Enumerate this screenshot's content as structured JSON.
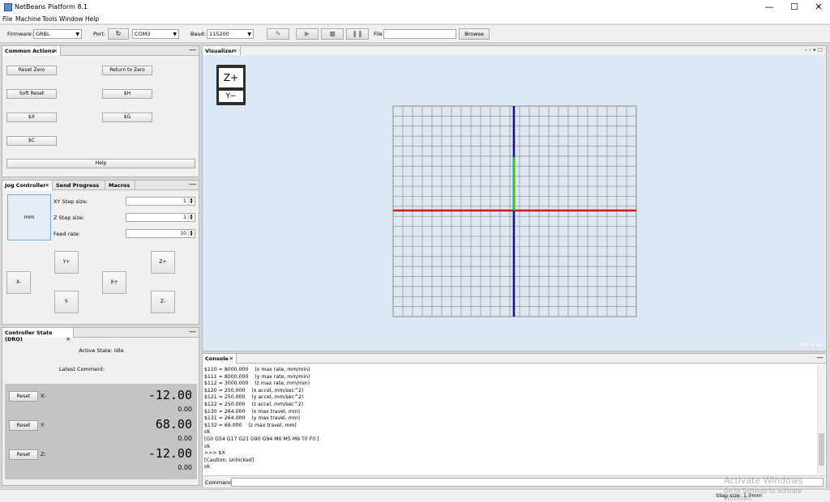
{
  "window": {
    "title": "NetBeans Platform 8.1",
    "min": "—",
    "max": "☐",
    "close": "✕"
  },
  "menu": [
    "File",
    "Machine",
    "Tools",
    "Window",
    "Help"
  ],
  "toolbar": {
    "firmware_label": "Firmware:",
    "firmware_value": "GRBL",
    "port_label": "Port:",
    "port_value": "COM3",
    "baud_label": "Baud:",
    "baud_value": "115200",
    "file_label": "File",
    "browse_label": "Browse"
  },
  "common_actions": {
    "tab": "Common Actions",
    "reset_zero": "Reset Zero",
    "return_to_zero": "Return to Zero",
    "soft_reset": "Soft Reset",
    "dollar_h": "$H",
    "dollar_x": "$X",
    "dollar_g": "$G",
    "dollar_c": "$C",
    "help": "Help"
  },
  "jog": {
    "tabs": [
      "Jog Controller",
      "Send Progress",
      "Macros"
    ],
    "unit": "mm",
    "xy_step_label": "XY Step size:",
    "xy_step_value": "1",
    "z_step_label": "Z Step size:",
    "z_step_value": "1",
    "feed_label": "Feed rate:",
    "feed_value": "10",
    "y_plus": "Y+",
    "y_minus": "Y-",
    "x_plus": "X+",
    "x_minus": "X-",
    "z_plus": "Z+",
    "z_minus": "Z-"
  },
  "dro": {
    "tab": "Controller State (DRO)",
    "active_state": "Active State: Idle",
    "latest_comment": "Latest Comment:",
    "axes": [
      {
        "reset": "Reset",
        "axis": "X:",
        "machine": "-12.00",
        "work": "0.00"
      },
      {
        "reset": "Reset",
        "axis": "Y:",
        "machine": "68.00",
        "work": "0.00"
      },
      {
        "reset": "Reset",
        "axis": "Z:",
        "machine": "-12.00",
        "work": "0.00"
      }
    ]
  },
  "visualizer": {
    "tab": "Visualizer",
    "z_plus": "Z+",
    "y_minus": "Y−",
    "fps": "FPS: 8.16",
    "nav": "‹ › ▾ ☐"
  },
  "console": {
    "tab": "Console",
    "lines": [
      "$110 = 8000.000    (x max rate, mm/min)",
      "$111 = 8000.000    (y max rate, mm/min)",
      "$112 = 3000.000    (z max rate, mm/min)",
      "$120 = 250.000    (x accel, mm/sec^2)",
      "$121 = 250.000    (y accel, mm/sec^2)",
      "$122 = 250.000    (z accel, mm/sec^2)",
      "$130 = 264.000    (x max travel, mm)",
      "$131 = 264.000    (y max travel, mm)",
      "$132 = 69.000    (z max travel, mm)",
      "ok",
      "[G0 G54 G17 G21 G90 G94 M0 M5 M9 T0 F0.]",
      "ok",
      ">>> $X",
      "[Caution: Unlocked]",
      "ok"
    ],
    "command_label": "Command:"
  },
  "status": {
    "step_size": "Step size: 1.0mm"
  },
  "watermark": {
    "line1": "Activate Windows",
    "line2": "Go to Settings to activate Windows."
  }
}
